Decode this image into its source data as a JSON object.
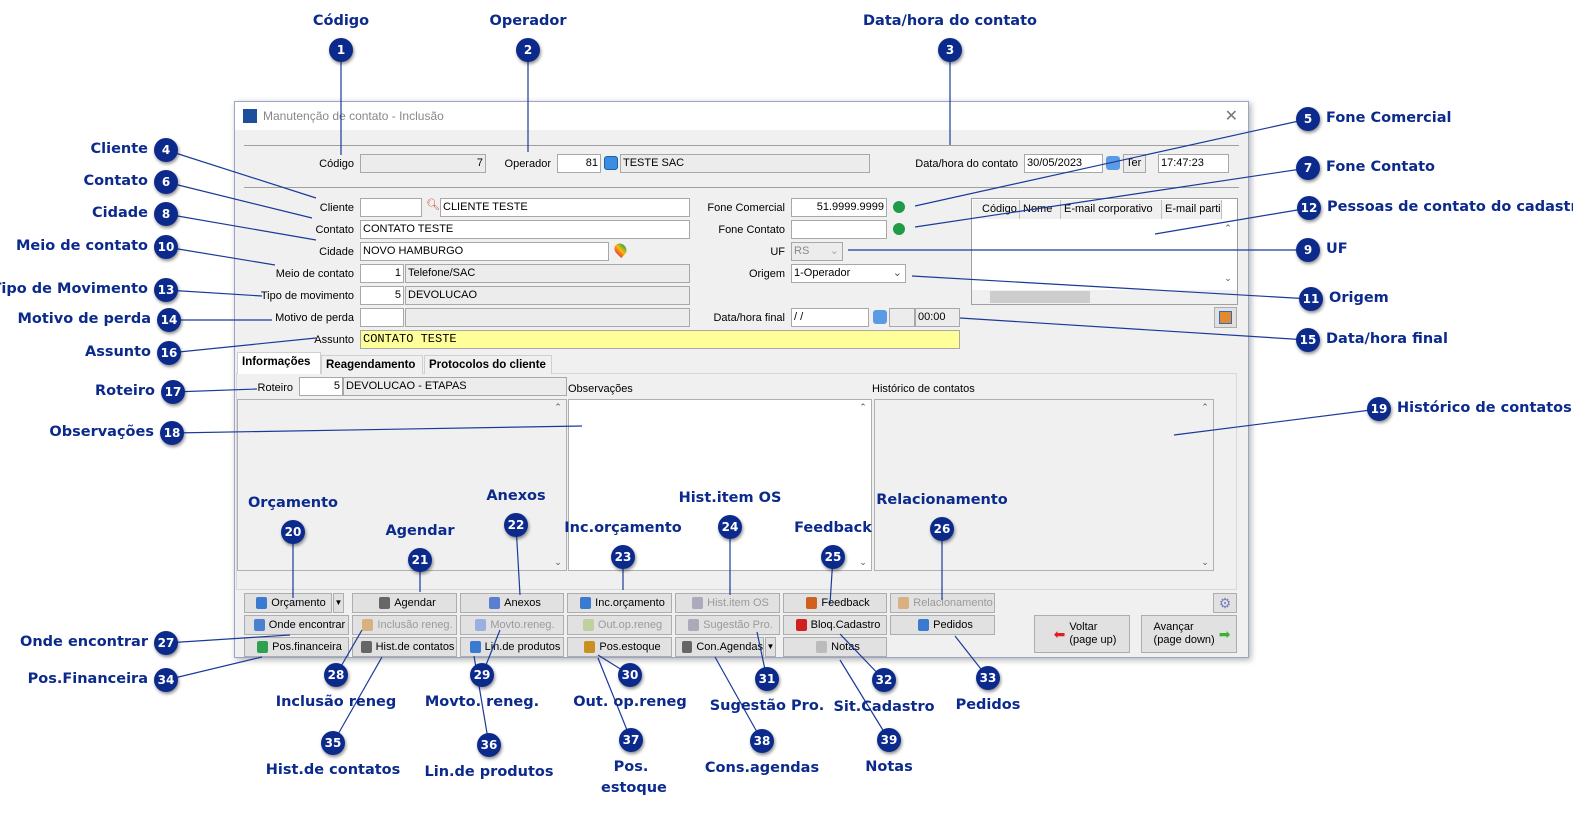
{
  "window": {
    "title": "Manutenção de contato - Inclusão",
    "close_icon": "close-icon"
  },
  "header": {
    "codigo_label": "Código",
    "codigo": "7",
    "operador_label": "Operador",
    "operador_code": "81",
    "operador_name": "TESTE SAC",
    "datahora_label": "Data/hora do contato",
    "date": "30/05/2023",
    "weekday": "Ter",
    "time": "17:47:23"
  },
  "form": {
    "cliente_label": "Cliente",
    "cliente_code": "",
    "cliente_name": "CLIENTE TESTE",
    "contato_label": "Contato",
    "contato": "CONTATO TESTE",
    "cidade_label": "Cidade",
    "cidade": "NOVO HAMBURGO",
    "meio_label": "Meio de contato",
    "meio_code": "1",
    "meio_name": "Telefone/SAC",
    "tipo_label": "Tipo de movimento",
    "tipo_code": "5",
    "tipo_name": "DEVOLUCAO",
    "motivo_label": "Motivo de perda",
    "motivo_code": "",
    "motivo_name": "",
    "assunto_label": "Assunto",
    "assunto": "CONTATO TESTE",
    "fone_com_label": "Fone Comercial",
    "fone_com": "51.9999.9999",
    "fone_cont_label": "Fone Contato",
    "fone_cont": "",
    "uf_label": "UF",
    "uf": "RS",
    "origem_label": "Origem",
    "origem": "1-Operador",
    "final_label": "Data/hora final",
    "final_date": "/ /",
    "final_time": "00:00"
  },
  "contacts_grid": {
    "columns": [
      "Código",
      "Nome",
      "E-mail corporativo",
      "E-mail parti"
    ]
  },
  "tabs": [
    "Informações",
    "Reagendamento",
    "Protocolos do cliente"
  ],
  "info": {
    "roteiro_label": "Roteiro",
    "roteiro_code": "5",
    "roteiro_name": "DEVOLUCAO - ETAPAS",
    "obs_label": "Observações",
    "hist_label": "Histórico de contatos"
  },
  "buttons": [
    {
      "label": "Orçamento",
      "enabled": true
    },
    {
      "label": "Agendar",
      "enabled": true
    },
    {
      "label": "Anexos",
      "enabled": true
    },
    {
      "label": "Inc.orçamento",
      "enabled": true
    },
    {
      "label": "Hist.item OS",
      "enabled": false
    },
    {
      "label": "Feedback",
      "enabled": true
    },
    {
      "label": "Relacionamento",
      "enabled": false
    },
    {
      "label": "Onde encontrar",
      "enabled": true
    },
    {
      "label": "Inclusão reneg.",
      "enabled": false
    },
    {
      "label": "Movto.reneg.",
      "enabled": false
    },
    {
      "label": "Out.op.reneg",
      "enabled": false
    },
    {
      "label": "Sugestão Pro.",
      "enabled": false
    },
    {
      "label": "Bloq.Cadastro",
      "enabled": true
    },
    {
      "label": "Pedidos",
      "enabled": true
    },
    {
      "label": "Pos.financeira",
      "enabled": true
    },
    {
      "label": "Hist.de contatos",
      "enabled": true
    },
    {
      "label": "Lin.de produtos",
      "enabled": true
    },
    {
      "label": "Pos.estoque",
      "enabled": true
    },
    {
      "label": "Con.Agendas",
      "enabled": true
    },
    {
      "label": "Notas",
      "enabled": true
    }
  ],
  "nav": {
    "back_line1": "Voltar",
    "back_line2": "(page up)",
    "next_line1": "Avançar",
    "next_line2": "(page down)"
  },
  "callouts": [
    {
      "n": "1",
      "label": "Código"
    },
    {
      "n": "2",
      "label": "Operador"
    },
    {
      "n": "3",
      "label": "Data/hora do contato"
    },
    {
      "n": "4",
      "label": "Cliente"
    },
    {
      "n": "5",
      "label": "Fone Comercial"
    },
    {
      "n": "6",
      "label": "Contato"
    },
    {
      "n": "7",
      "label": "Fone Contato"
    },
    {
      "n": "8",
      "label": "Cidade"
    },
    {
      "n": "9",
      "label": "UF"
    },
    {
      "n": "10",
      "label": "Meio de contato"
    },
    {
      "n": "11",
      "label": "Origem"
    },
    {
      "n": "12",
      "label": "Pessoas de contato do cadastro"
    },
    {
      "n": "13",
      "label": "Tipo de Movimento"
    },
    {
      "n": "14",
      "label": "Motivo de perda"
    },
    {
      "n": "15",
      "label": "Data/hora final"
    },
    {
      "n": "16",
      "label": "Assunto"
    },
    {
      "n": "17",
      "label": "Roteiro"
    },
    {
      "n": "18",
      "label": "Observações"
    },
    {
      "n": "19",
      "label": "Histórico de contatos"
    },
    {
      "n": "20",
      "label": "Orçamento"
    },
    {
      "n": "21",
      "label": "Agendar"
    },
    {
      "n": "22",
      "label": "Anexos"
    },
    {
      "n": "23",
      "label": "Inc.orçamento"
    },
    {
      "n": "24",
      "label": "Hist.item OS"
    },
    {
      "n": "25",
      "label": "Feedback"
    },
    {
      "n": "26",
      "label": "Relacionamento"
    },
    {
      "n": "27",
      "label": "Onde encontrar"
    },
    {
      "n": "28",
      "label": "Inclusão reneg"
    },
    {
      "n": "29",
      "label": "Movto. reneg."
    },
    {
      "n": "30",
      "label": "Out. op.reneg"
    },
    {
      "n": "31",
      "label": "Sugestão Pro."
    },
    {
      "n": "32",
      "label": "Sit.Cadastro"
    },
    {
      "n": "33",
      "label": "Pedidos"
    },
    {
      "n": "34",
      "label": "Pos.Financeira"
    },
    {
      "n": "35",
      "label": "Hist.de contatos"
    },
    {
      "n": "36",
      "label": "Lin.de produtos"
    },
    {
      "n": "37",
      "label": "Pos. estoque"
    },
    {
      "n": "38",
      "label": "Cons.agendas"
    },
    {
      "n": "39",
      "label": "Notas"
    }
  ],
  "colors": {
    "callout": "#0b2a8c",
    "assunto_bg": "#ffff99",
    "whatsapp": "#1f9b48"
  }
}
